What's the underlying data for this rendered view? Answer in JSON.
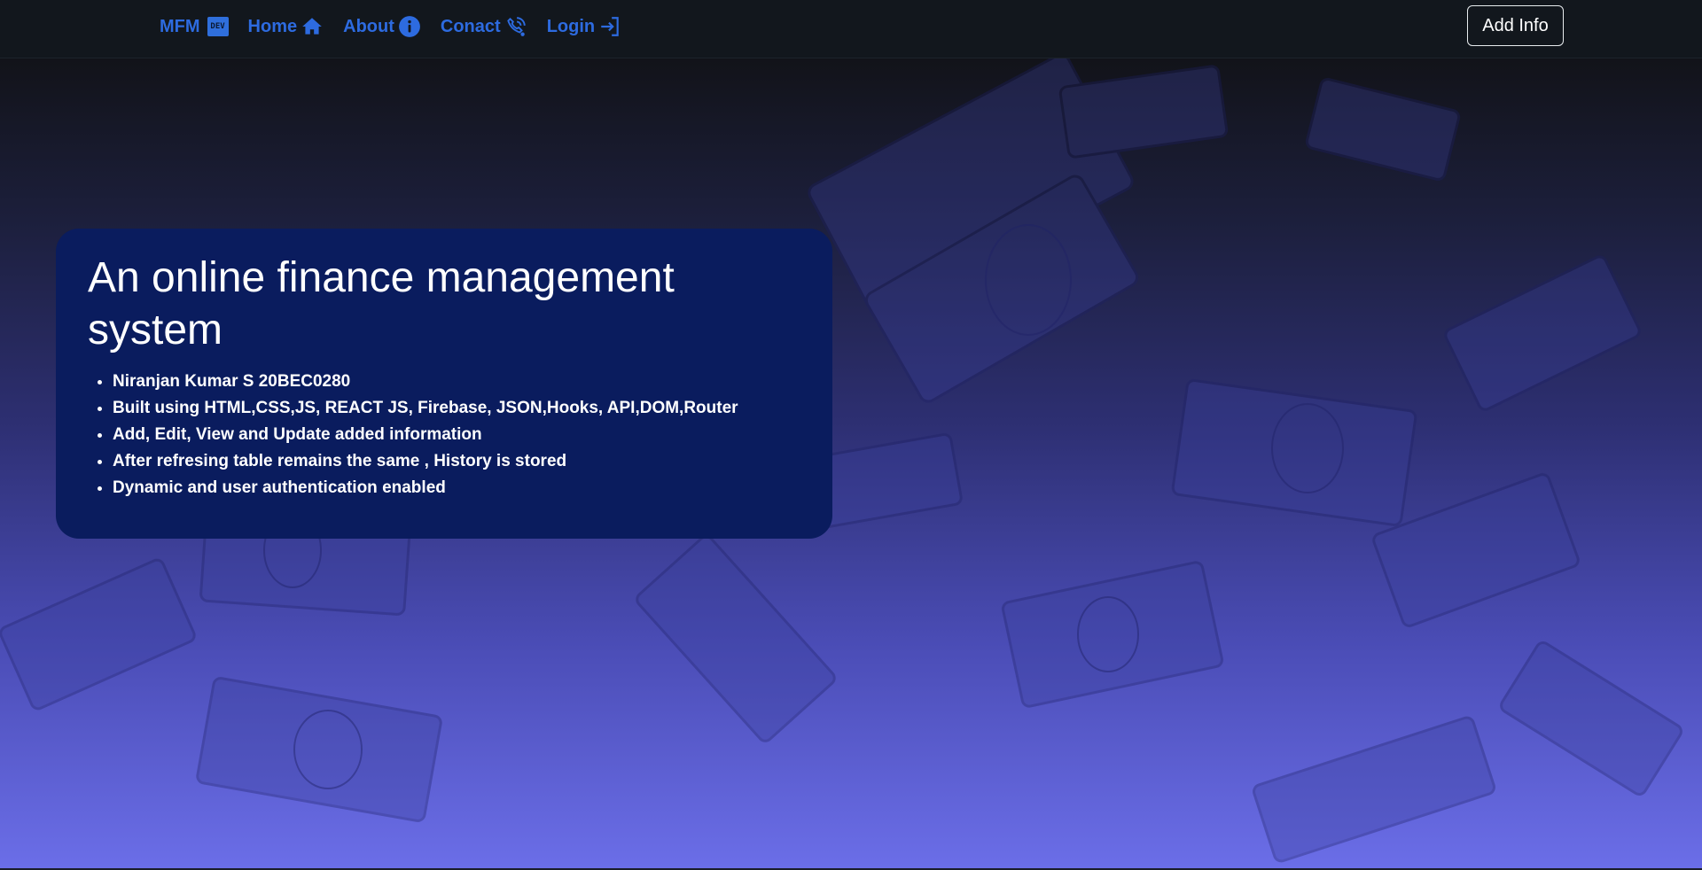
{
  "navbar": {
    "brand": {
      "label": "MFM",
      "badge": "DEV"
    },
    "links": [
      {
        "label": "Home",
        "icon": "home-icon"
      },
      {
        "label": "About",
        "icon": "info-icon"
      },
      {
        "label": "Conact",
        "icon": "contact-icon"
      },
      {
        "label": "Login",
        "icon": "login-icon"
      }
    ],
    "add_info_label": "Add Info"
  },
  "hero": {
    "title": "An online finance management system",
    "features": [
      "Niranjan Kumar S 20BEC0280",
      "Built using HTML,CSS,JS, REACT JS, Firebase, JSON,Hooks, API,DOM,Router",
      "Add, Edit, View and Update added information",
      "After refresing table remains the same , History is stored",
      "Dynamic and user authentication enabled"
    ]
  },
  "colors": {
    "nav_bg": "#12171d",
    "link": "#2d6be0",
    "card_bg": "#0a1c5e",
    "gradient_top": "#121319",
    "gradient_bottom": "#6b6ee8"
  }
}
